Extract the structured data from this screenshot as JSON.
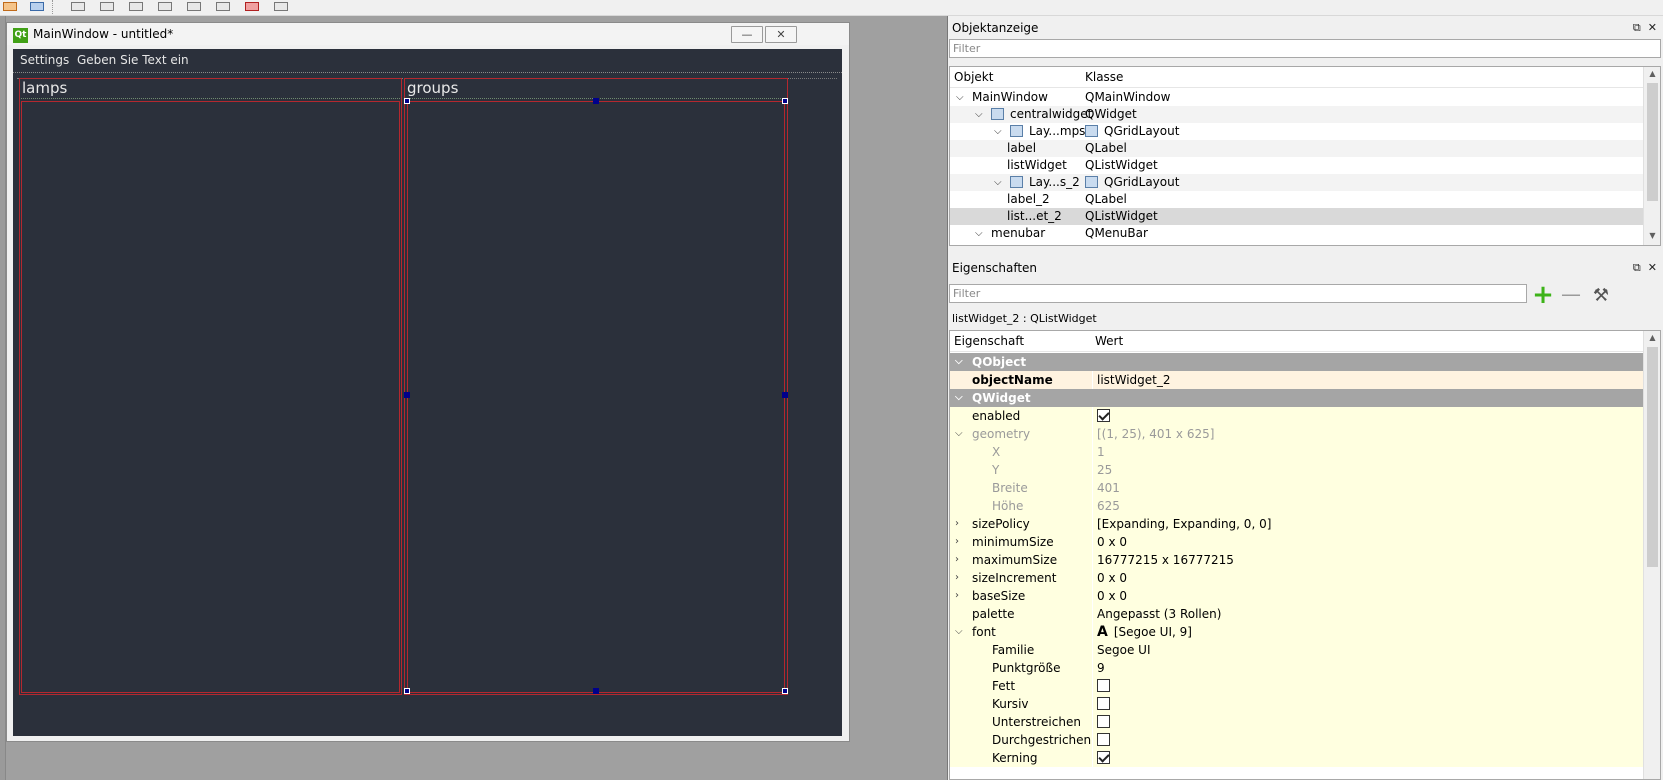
{
  "form": {
    "title": "MainWindow - untitled*",
    "logo_text": "Qt",
    "minimize_glyph": "—",
    "close_glyph": "✕",
    "menubar": [
      "Settings",
      "Geben Sie Text ein"
    ],
    "label_left": "lamps",
    "label_right": "groups"
  },
  "object_inspector": {
    "title": "Objektanzeige",
    "filter_placeholder": "Filter",
    "header": {
      "object": "Objekt",
      "class": "Klasse"
    },
    "rows": [
      {
        "object": "MainWindow",
        "class": "QMainWindow",
        "level": 0,
        "expanded": true
      },
      {
        "object": "centralwidget",
        "class": "QWidget",
        "level": 1,
        "expanded": true
      },
      {
        "object": "Lay...mps",
        "class": "QGridLayout",
        "level": 2,
        "expanded": true
      },
      {
        "object": "label",
        "class": "QLabel",
        "level": 3
      },
      {
        "object": "listWidget",
        "class": "QListWidget",
        "level": 3
      },
      {
        "object": "Lay...s_2",
        "class": "QGridLayout",
        "level": 2,
        "expanded": true
      },
      {
        "object": "label_2",
        "class": "QLabel",
        "level": 3
      },
      {
        "object": "list...et_2",
        "class": "QListWidget",
        "level": 3,
        "selected": true
      },
      {
        "object": "menubar",
        "class": "QMenuBar",
        "level": 1,
        "expanded": true
      }
    ]
  },
  "property_editor": {
    "title": "Eigenschaften",
    "filter_placeholder": "Filter",
    "selected_object": "listWidget_2 : QListWidget",
    "header": {
      "property": "Eigenschaft",
      "value": "Wert"
    },
    "rows": [
      {
        "type": "group",
        "key": "QObject"
      },
      {
        "type": "orange",
        "key": "objectName",
        "value": "listWidget_2",
        "bold": true
      },
      {
        "type": "group",
        "key": "QWidget"
      },
      {
        "type": "yellow",
        "key": "enabled",
        "checkbox": true,
        "checked": true
      },
      {
        "type": "yellow",
        "key": "geometry",
        "value": "[(1, 25), 401 x 625]",
        "expander": "open",
        "grey": true
      },
      {
        "type": "yellow",
        "key": "X",
        "value": "1",
        "sub": true,
        "grey": true
      },
      {
        "type": "yellow",
        "key": "Y",
        "value": "25",
        "sub": true,
        "grey": true
      },
      {
        "type": "yellow",
        "key": "Breite",
        "value": "401",
        "sub": true,
        "grey": true
      },
      {
        "type": "yellow",
        "key": "Höhe",
        "value": "625",
        "sub": true,
        "grey": true
      },
      {
        "type": "yellow",
        "key": "sizePolicy",
        "value": "[Expanding, Expanding, 0, 0]",
        "expander": "closed"
      },
      {
        "type": "yellow",
        "key": "minimumSize",
        "value": "0 x 0",
        "expander": "closed"
      },
      {
        "type": "yellow",
        "key": "maximumSize",
        "value": "16777215 x 16777215",
        "expander": "closed"
      },
      {
        "type": "yellow",
        "key": "sizeIncrement",
        "value": "0 x 0",
        "expander": "closed"
      },
      {
        "type": "yellow",
        "key": "baseSize",
        "value": "0 x 0",
        "expander": "closed"
      },
      {
        "type": "yellow",
        "key": "palette",
        "value": "Angepasst (3 Rollen)"
      },
      {
        "type": "yellow",
        "key": "font",
        "value": "[Segoe UI, 9]",
        "expander": "open",
        "font_icon": "A"
      },
      {
        "type": "yellow",
        "key": "Familie",
        "value": "Segoe UI",
        "sub": true
      },
      {
        "type": "yellow",
        "key": "Punktgröße",
        "value": "9",
        "sub": true
      },
      {
        "type": "yellow",
        "key": "Fett",
        "checkbox": true,
        "checked": false,
        "sub": true
      },
      {
        "type": "yellow",
        "key": "Kursiv",
        "checkbox": true,
        "checked": false,
        "sub": true
      },
      {
        "type": "yellow",
        "key": "Unterstreichen",
        "checkbox": true,
        "checked": false,
        "sub": true
      },
      {
        "type": "yellow",
        "key": "Durchgestrichen",
        "checkbox": true,
        "checked": false,
        "sub": true
      },
      {
        "type": "yellow",
        "key": "Kerning",
        "checkbox": true,
        "checked": true,
        "sub": true
      }
    ]
  },
  "icons": [
    "dock-float-icon",
    "dock-close-icon",
    "chevron-down-icon",
    "chevron-right-icon",
    "layout-icon",
    "add-icon",
    "remove-icon",
    "wrench-icon",
    "checkbox-icon"
  ],
  "colors": {
    "form_bg": "#2b303b",
    "frame_red": "#b4282f",
    "handle": "#00008b",
    "group_bg": "#a5a5a5",
    "yellow_row": "#ffffe0",
    "orange_row": "#fff3e0"
  }
}
